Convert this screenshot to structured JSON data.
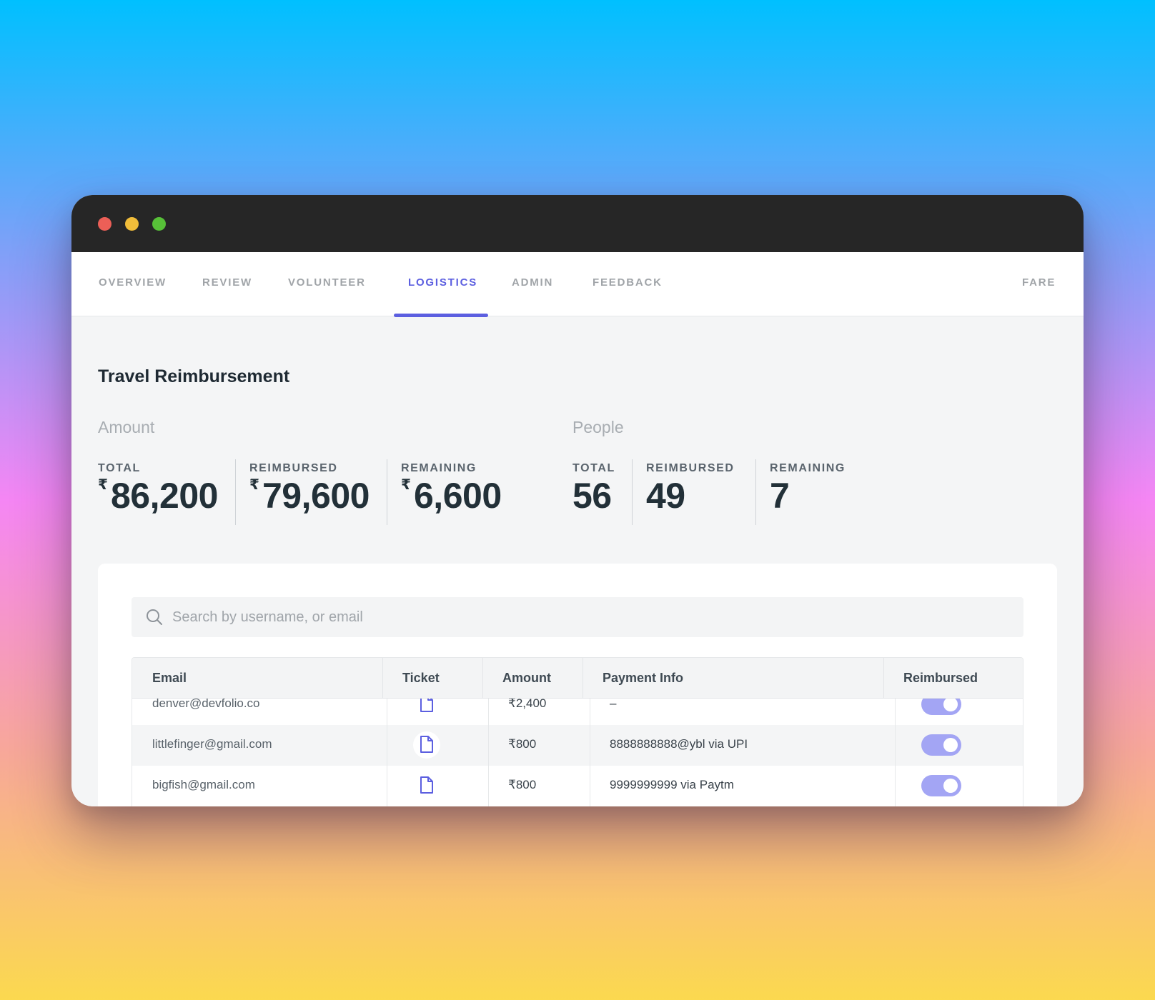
{
  "nav": {
    "tabs": [
      {
        "label": "OVERVIEW"
      },
      {
        "label": "REVIEW"
      },
      {
        "label": "VOLUNTEER"
      },
      {
        "label": "LOGISTICS",
        "active": true
      },
      {
        "label": "ADMIN"
      },
      {
        "label": "FEEDBACK"
      }
    ],
    "right_label": "FARE"
  },
  "page": {
    "title": "Travel Reimbursement"
  },
  "amount": {
    "heading": "Amount",
    "currency": "₹",
    "total_label": "TOTAL",
    "total_value": "86,200",
    "reimbursed_label": "REIMBURSED",
    "reimbursed_value": "79,600",
    "remaining_label": "REMAINING",
    "remaining_value": "6,600"
  },
  "people": {
    "heading": "People",
    "total_label": "TOTAL",
    "total_value": "56",
    "reimbursed_label": "REIMBURSED",
    "reimbursed_value": "49",
    "remaining_label": "REMAINING",
    "remaining_value": "7"
  },
  "search": {
    "placeholder": "Search by username, or email",
    "value": ""
  },
  "table": {
    "columns": [
      "Email",
      "Ticket",
      "Amount",
      "Payment Info",
      "Reimbursed"
    ],
    "rows": [
      {
        "email": "denver@devfolio.co",
        "amount": "₹2,400",
        "payment": "–",
        "reimbursed": true
      },
      {
        "email": "littlefinger@gmail.com",
        "amount": "₹800",
        "payment": "8888888888@ybl via UPI",
        "reimbursed": true
      },
      {
        "email": "bigfish@gmail.com",
        "amount": "₹800",
        "payment": "9999999999 via Paytm",
        "reimbursed": true
      }
    ]
  },
  "colors": {
    "accent": "#5c5fe0",
    "toggle_on": "#a3a5f4"
  }
}
